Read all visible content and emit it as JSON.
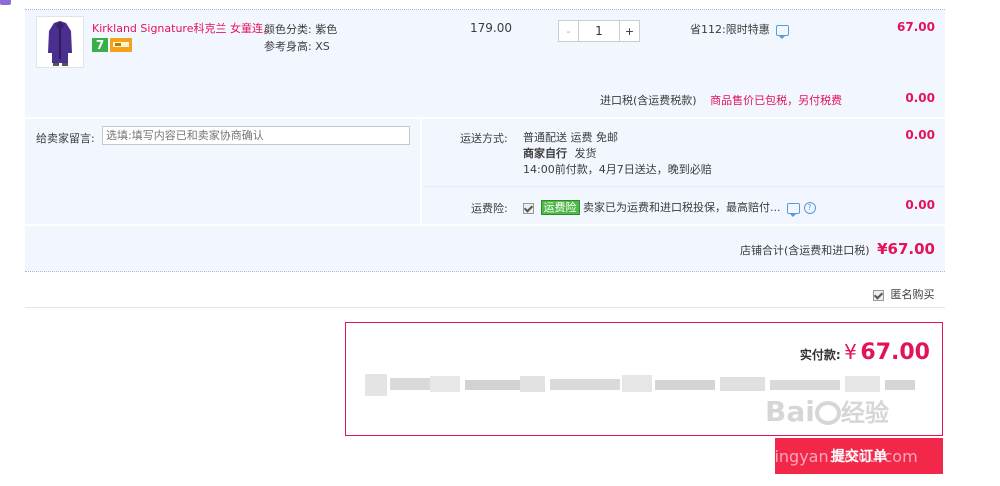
{
  "product": {
    "name": "Kirkland Signature科克兰 女童连...",
    "spec_color_label": "颜色分类:",
    "spec_color_value": "紫色",
    "spec_height_label": "参考身高:",
    "spec_height_value": "XS",
    "unit_price": "179.00",
    "qty_minus": "-",
    "quantity": "1",
    "qty_plus": "+",
    "discount": "省112:限时特惠",
    "subtotal": "67.00",
    "badge_seven": "7"
  },
  "import_tax": {
    "label": "进口税(含运费税款)",
    "note": "商品售价已包税，另付税费",
    "amount": "0.00"
  },
  "message": {
    "label": "给卖家留言:",
    "placeholder": "选填:填写内容已和卖家协商确认"
  },
  "shipping": {
    "label": "运送方式:",
    "method": "普通配送 运费 免邮",
    "carrier_bold": "商家自行",
    "carrier_rest": "发货",
    "eta": "14:00前付款，4月7日送达，晚到必赔",
    "amount": "0.00"
  },
  "insurance": {
    "label": "运费险:",
    "tag": "运费险",
    "desc": "卖家已为运费和进口税投保，最高赔付...",
    "amount": "0.00"
  },
  "shop_total": {
    "label": "店铺合计(含运费和进口税)",
    "amount": "¥67.00"
  },
  "anonymous": {
    "label": "匿名购买"
  },
  "payment": {
    "label": "实付款:",
    "currency": "¥",
    "amount": "67.00"
  },
  "submit": {
    "label": "提交订单"
  },
  "watermark": {
    "logo": "Bai",
    "logo_tail": "经验",
    "url": "jingyan.baidu.com"
  },
  "colors": {
    "accent_red": "#e3135a",
    "submit_bg": "#f2274a",
    "panel_bg": "#f2f7ff",
    "border_red": "#e3135a"
  }
}
